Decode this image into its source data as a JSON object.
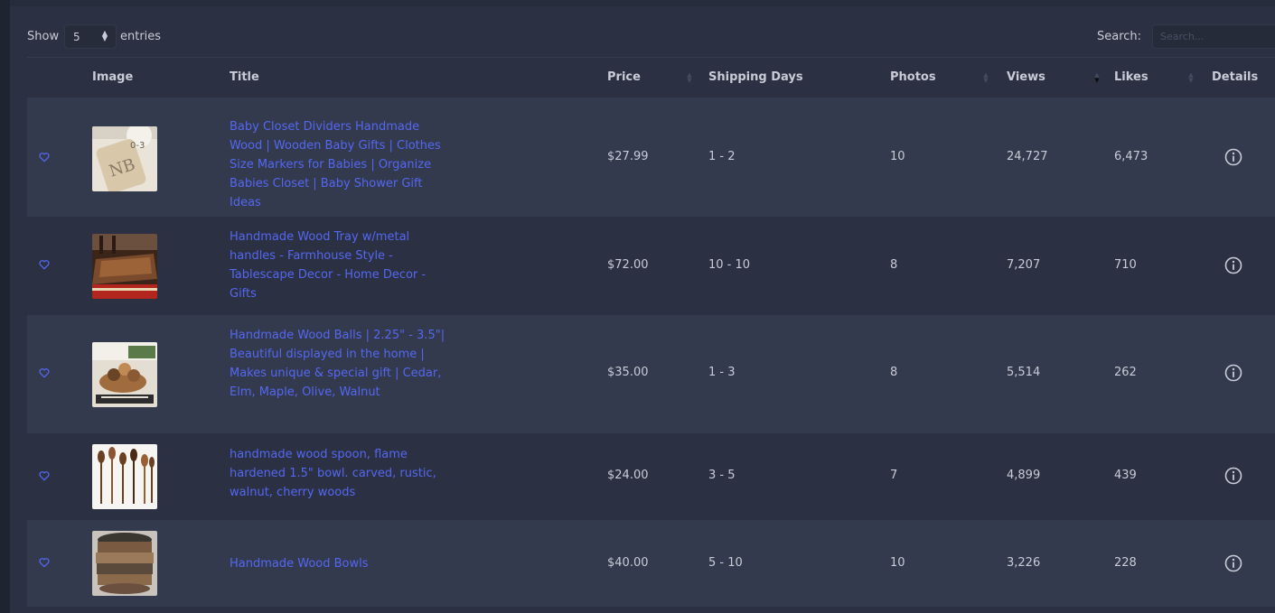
{
  "controls": {
    "show_label": "Show",
    "length_value": "5",
    "entries_label": "entries",
    "search_label": "Search:",
    "search_placeholder": "Search..."
  },
  "columns": {
    "image": "Image",
    "title": "Title",
    "price": "Price",
    "shipping_days": "Shipping Days",
    "photos": "Photos",
    "views": "Views",
    "likes": "Likes",
    "details": "Details"
  },
  "rows": [
    {
      "title": "Baby Closet Dividers Handmade Wood | Wooden Baby Gifts | Clothes Size Markers for Babies | Organize Babies Closet | Baby Shower Gift Ideas",
      "price": "$27.99",
      "shipping_days": "1 - 2",
      "photos": "10",
      "views": "24,727",
      "likes": "6,473",
      "image_icon": "closet-divider-thumbnail"
    },
    {
      "title": "Handmade Wood Tray w/metal handles - Farmhouse Style - Tablescape Decor - Home Decor - Gifts",
      "price": "$72.00",
      "shipping_days": "10 - 10",
      "photos": "8",
      "views": "7,207",
      "likes": "710",
      "image_icon": "wood-tray-thumbnail"
    },
    {
      "title": "Handmade Wood Balls | 2.25\" - 3.5\"| Beautiful displayed in the home | Makes unique & special gift | Cedar, Elm, Maple, Olive, Walnut",
      "price": "$35.00",
      "shipping_days": "1 - 3",
      "photos": "8",
      "views": "5,514",
      "likes": "262",
      "image_icon": "wood-balls-thumbnail"
    },
    {
      "title": "handmade wood spoon, flame hardened 1.5\" bowl. carved, rustic, walnut, cherry woods",
      "price": "$24.00",
      "shipping_days": "3 - 5",
      "photos": "7",
      "views": "4,899",
      "likes": "439",
      "image_icon": "wood-spoons-thumbnail"
    },
    {
      "title": "Handmade Wood Bowls",
      "price": "$40.00",
      "shipping_days": "5 - 10",
      "photos": "10",
      "views": "3,226",
      "likes": "228",
      "image_icon": "wood-bowls-thumbnail"
    }
  ],
  "colors": {
    "background": "#2b3142",
    "row_alt": "#333a4d",
    "link": "#5467f2",
    "text": "#c9ccd6"
  }
}
